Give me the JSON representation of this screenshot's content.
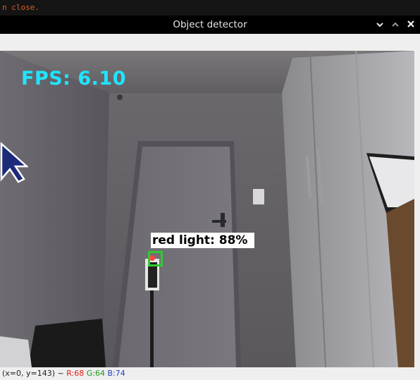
{
  "terminal": {
    "text": "n close."
  },
  "window": {
    "title": "Object detector",
    "buttons": {
      "minimize": "ˇ",
      "maximize": "^",
      "close": "✕"
    }
  },
  "overlay": {
    "fps_text": "FPS: 6.10",
    "detection_label": "red light: 88%",
    "detection_box_color": "#2ecc2e",
    "fps_color": "#1fe5ff"
  },
  "status": {
    "coords": "(x=0, y=143) ~ ",
    "r": "R:68",
    "g": "G:64",
    "b": "B:74",
    "r_color": "#e02020",
    "g_color": "#1a9a1a",
    "b_color": "#2040d0"
  }
}
